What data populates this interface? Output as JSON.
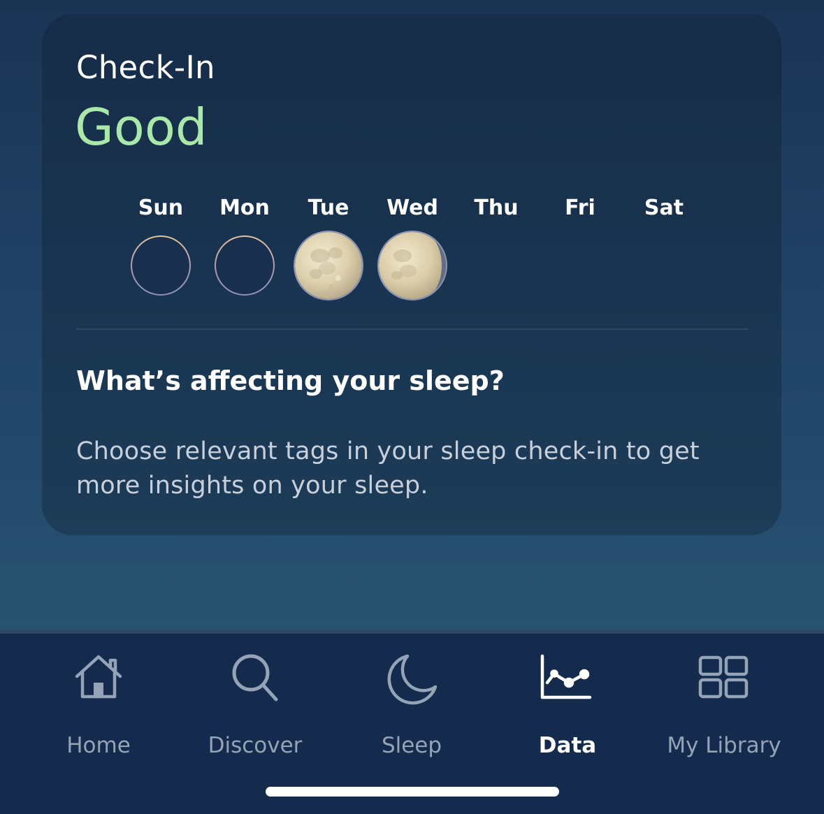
{
  "checkin": {
    "title": "Check-In",
    "status": "Good",
    "status_color": "#a9e8a8"
  },
  "week": [
    {
      "label": "Sun",
      "state": "empty"
    },
    {
      "label": "Mon",
      "state": "empty"
    },
    {
      "label": "Tue",
      "state": "full-moon"
    },
    {
      "label": "Wed",
      "state": "gibbous-moon"
    },
    {
      "label": "Thu",
      "state": "none"
    },
    {
      "label": "Fri",
      "state": "none"
    },
    {
      "label": "Sat",
      "state": "none"
    }
  ],
  "insights": {
    "question": "What’s affecting your sleep?",
    "helper": "Choose relevant tags in your sleep check-in to get more insights on your sleep."
  },
  "tabbar": {
    "active": "Data",
    "tabs": [
      {
        "label": "Home",
        "icon": "home-icon"
      },
      {
        "label": "Discover",
        "icon": "search-icon"
      },
      {
        "label": "Sleep",
        "icon": "moon-icon"
      },
      {
        "label": "Data",
        "icon": "chart-icon"
      },
      {
        "label": "My Library",
        "icon": "grid-icon"
      }
    ]
  },
  "colors": {
    "background": "#1f4063",
    "card": "#183150",
    "tabbar": "#142b4d",
    "inactive_tab": "#95a3b7"
  }
}
